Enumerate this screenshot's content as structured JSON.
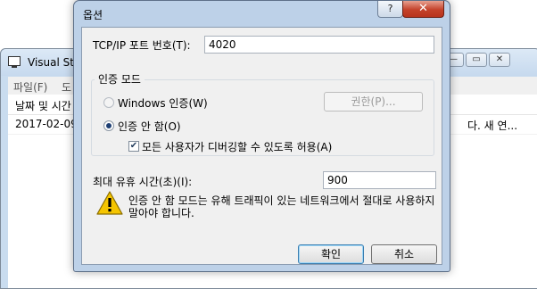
{
  "background_window": {
    "title": "Visual Stu",
    "controls": [
      "—",
      "▭",
      "✕"
    ],
    "menus": [
      "파일(F)",
      "도"
    ],
    "column_header": "날짜 및 시간",
    "row": {
      "date": "2017-02-09",
      "message_tail": "다. 새 연..."
    }
  },
  "dialog": {
    "title": "옵션",
    "help_glyph": "?",
    "close_glyph": "✕",
    "port": {
      "label": "TCP/IP 포트 번호(T):",
      "value": "4020"
    },
    "auth_group": {
      "title": "인증 모드",
      "windows_auth_label": "Windows 인증(W)",
      "permissions_button": "권한(P)...",
      "no_auth_label": "인증 안 함(O)",
      "allow_any_user_label": "모든 사용자가 디버깅할 수 있도록 허용(A)",
      "selected": "no_auth",
      "allow_any_user_checked": true
    },
    "idle_time": {
      "label": "최대 유휴 시간(초)(I):",
      "value": "900"
    },
    "warning": "인증 안 함 모드는 유해 트래픽이 있는 네트워크에서 절대로 사용하지 말아야 합니다.",
    "ok_button": "확인",
    "cancel_button": "취소",
    "colors": {
      "titlebar": "#bdd1e8",
      "close_button": "#c4422b",
      "body": "#f0f0f0"
    }
  }
}
